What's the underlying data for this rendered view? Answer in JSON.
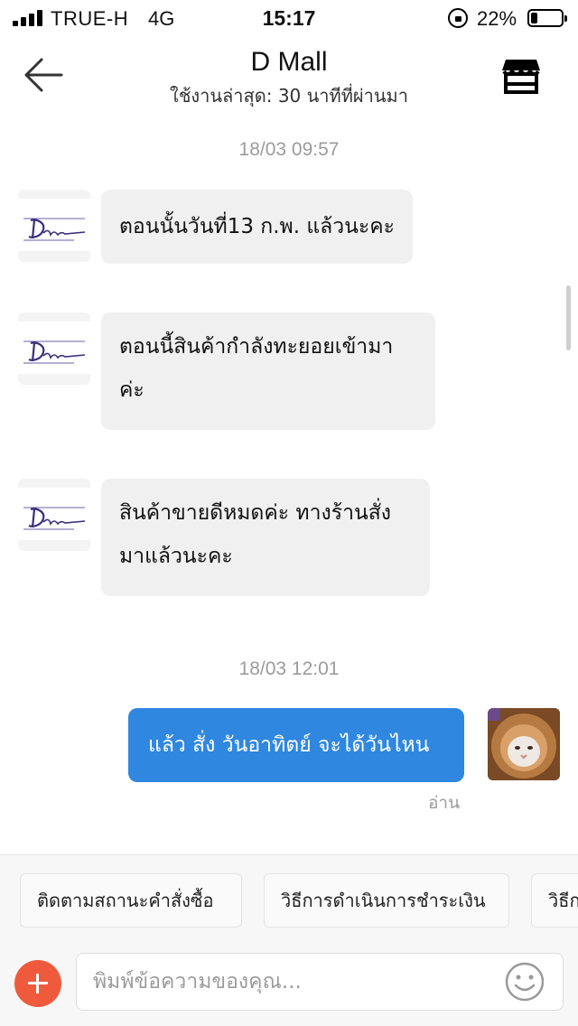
{
  "status_bar": {
    "carrier": "TRUE-H",
    "network": "4G",
    "time": "15:17",
    "battery_percent": "22%",
    "battery_level": 0.22
  },
  "header": {
    "title": "D Mall",
    "last_active": "ใช้งานล่าสุด: 30 นาทีที่ผ่านมา"
  },
  "chat": {
    "timestamp_1": "18/03 09:57",
    "shop_messages": [
      {
        "line1": "ตอนนั้นวันที่13 ก.พ. แล้วนะคะ",
        "line2": ""
      },
      {
        "line1": "ตอนนี้สินค้ากำลังทะยอยเข้ามา",
        "line2": "ค่ะ"
      },
      {
        "line1": "สินค้าขายดีหมดค่ะ ทางร้านสั่ง",
        "line2": "มาแล้วนะคะ"
      }
    ],
    "timestamp_2": "18/03 12:01",
    "user_message": "แล้ว สั่ง วันอาทิตย์ จะได้วันไหน",
    "read_status": "อ่าน"
  },
  "quick_replies": [
    "ติดตามสถานะคำสั่งซื้อ",
    "วิธีการดำเนินการชำระเงิน",
    "วิธีก"
  ],
  "input": {
    "placeholder": "พิมพ์ข้อความของคุณ..."
  },
  "colors": {
    "outgoing_bubble": "#2f87e0",
    "incoming_bubble": "#f0f0f0",
    "add_button": "#f05a3c"
  },
  "icons": [
    "signal-icon",
    "rotation-lock-icon",
    "battery-icon",
    "back-arrow-icon",
    "shop-icon",
    "add-icon",
    "emoji-icon"
  ]
}
